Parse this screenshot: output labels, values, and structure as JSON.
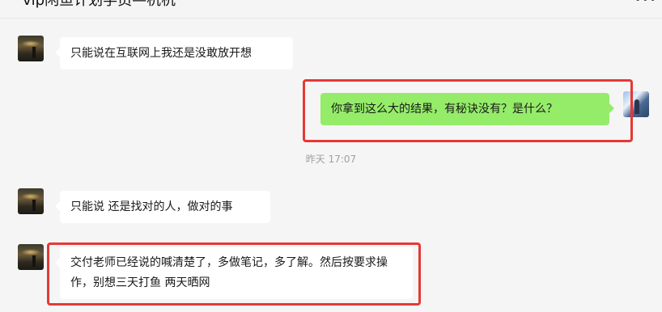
{
  "header": {
    "title": "vip闲鱼计划学员—杭杭",
    "more_icon": "more-icon"
  },
  "messages": [
    {
      "side": "left",
      "text": "只能说在互联网上我还是没敢放开想"
    },
    {
      "side": "right",
      "text": "你拿到这么大的结果，有秘诀没有？是什么？"
    },
    {
      "side": "left",
      "text": "只能说 还是找对的人，做对的事"
    },
    {
      "side": "left",
      "text": "交付老师已经说的喊清楚了，多做笔记，多了解。然后按要求操作，别想三天打鱼 两天晒网"
    }
  ],
  "timestamp": "昨天 17:07",
  "colors": {
    "highlight": "#e53935",
    "self_bubble": "#95ec69",
    "other_bubble": "#ffffff",
    "background": "#f5f5f5"
  }
}
